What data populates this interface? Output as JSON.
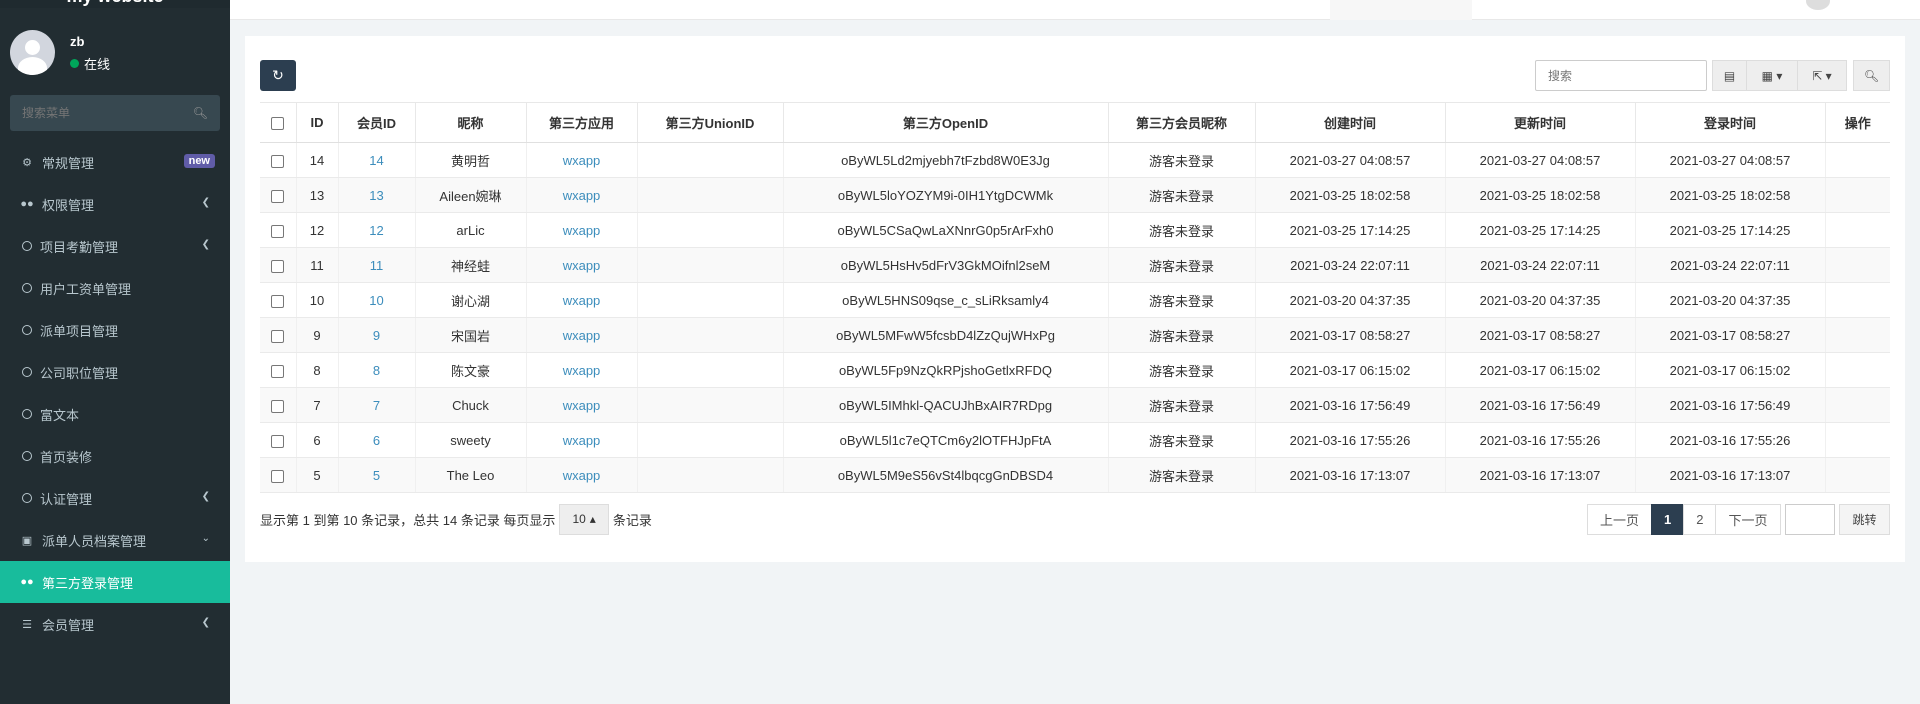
{
  "app": {
    "logo_text": "my website"
  },
  "user": {
    "name": "zb",
    "status": "在线"
  },
  "sidebar": {
    "search_placeholder": "搜索菜单",
    "items": [
      {
        "label": "常规管理",
        "icon": "cogs-icon",
        "badge": "new"
      },
      {
        "label": "权限管理",
        "icon": "group-icon",
        "arrow": "chevron-left-icon"
      },
      {
        "label": "项目考勤管理",
        "icon": "circle-icon",
        "arrow": "chevron-left-icon"
      },
      {
        "label": "用户工资单管理",
        "icon": "circle-icon"
      },
      {
        "label": "派单项目管理",
        "icon": "circle-icon"
      },
      {
        "label": "公司职位管理",
        "icon": "circle-icon"
      },
      {
        "label": "富文本",
        "icon": "circle-icon"
      },
      {
        "label": "首页装修",
        "icon": "circle-icon"
      },
      {
        "label": "认证管理",
        "icon": "circle-icon",
        "arrow": "chevron-left-icon"
      },
      {
        "label": "派单人员档案管理",
        "icon": "id-card-icon",
        "arrow": "chevron-down-icon"
      },
      {
        "label": "第三方登录管理",
        "icon": "users-icon",
        "active": true
      },
      {
        "label": "会员管理",
        "icon": "list-icon",
        "arrow": "chevron-left-icon"
      }
    ]
  },
  "toolbar": {
    "search_placeholder": "搜索"
  },
  "table": {
    "columns": [
      "ID",
      "会员ID",
      "昵称",
      "第三方应用",
      "第三方UnionID",
      "第三方OpenID",
      "第三方会员昵称",
      "创建时间",
      "更新时间",
      "登录时间",
      "操作"
    ],
    "rows": [
      {
        "id": "14",
        "member_id": "14",
        "nickname": "黄明哲",
        "app": "wxapp",
        "unionid": "",
        "openid": "oByWL5Ld2mjyebh7tFzbd8W0E3Jg",
        "third_nick": "游客未登录",
        "created": "2021-03-27 04:08:57",
        "updated": "2021-03-27 04:08:57",
        "login": "2021-03-27 04:08:57"
      },
      {
        "id": "13",
        "member_id": "13",
        "nickname": "Aileen婉琳",
        "app": "wxapp",
        "unionid": "",
        "openid": "oByWL5loYOZYM9i-0IH1YtgDCWMk",
        "third_nick": "游客未登录",
        "created": "2021-03-25 18:02:58",
        "updated": "2021-03-25 18:02:58",
        "login": "2021-03-25 18:02:58"
      },
      {
        "id": "12",
        "member_id": "12",
        "nickname": "arLic",
        "app": "wxapp",
        "unionid": "",
        "openid": "oByWL5CSaQwLaXNnrG0p5rArFxh0",
        "third_nick": "游客未登录",
        "created": "2021-03-25 17:14:25",
        "updated": "2021-03-25 17:14:25",
        "login": "2021-03-25 17:14:25"
      },
      {
        "id": "11",
        "member_id": "11",
        "nickname": "神经蛙",
        "app": "wxapp",
        "unionid": "",
        "openid": "oByWL5HsHv5dFrV3GkMOifnl2seM",
        "third_nick": "游客未登录",
        "created": "2021-03-24 22:07:11",
        "updated": "2021-03-24 22:07:11",
        "login": "2021-03-24 22:07:11"
      },
      {
        "id": "10",
        "member_id": "10",
        "nickname": "谢心湖",
        "app": "wxapp",
        "unionid": "",
        "openid": "oByWL5HNS09qse_c_sLiRksamly4",
        "third_nick": "游客未登录",
        "created": "2021-03-20 04:37:35",
        "updated": "2021-03-20 04:37:35",
        "login": "2021-03-20 04:37:35"
      },
      {
        "id": "9",
        "member_id": "9",
        "nickname": "宋国岩",
        "app": "wxapp",
        "unionid": "",
        "openid": "oByWL5MFwW5fcsbD4lZzQujWHxPg",
        "third_nick": "游客未登录",
        "created": "2021-03-17 08:58:27",
        "updated": "2021-03-17 08:58:27",
        "login": "2021-03-17 08:58:27"
      },
      {
        "id": "8",
        "member_id": "8",
        "nickname": "陈文豪",
        "app": "wxapp",
        "unionid": "",
        "openid": "oByWL5Fp9NzQkRPjshoGetlxRFDQ",
        "third_nick": "游客未登录",
        "created": "2021-03-17 06:15:02",
        "updated": "2021-03-17 06:15:02",
        "login": "2021-03-17 06:15:02"
      },
      {
        "id": "7",
        "member_id": "7",
        "nickname": "Chuck",
        "app": "wxapp",
        "unionid": "",
        "openid": "oByWL5IMhkl-QACUJhBxAIR7RDpg",
        "third_nick": "游客未登录",
        "created": "2021-03-16 17:56:49",
        "updated": "2021-03-16 17:56:49",
        "login": "2021-03-16 17:56:49"
      },
      {
        "id": "6",
        "member_id": "6",
        "nickname": "sweety",
        "app": "wxapp",
        "unionid": "",
        "openid": "oByWL5l1c7eQTCm6y2lOTFHJpFtA",
        "third_nick": "游客未登录",
        "created": "2021-03-16 17:55:26",
        "updated": "2021-03-16 17:55:26",
        "login": "2021-03-16 17:55:26"
      },
      {
        "id": "5",
        "member_id": "5",
        "nickname": "The Leo",
        "app": "wxapp",
        "unionid": "",
        "openid": "oByWL5M9eS56vSt4lbqcgGnDBSD4",
        "third_nick": "游客未登录",
        "created": "2021-03-16 17:13:07",
        "updated": "2021-03-16 17:13:07",
        "login": "2021-03-16 17:13:07"
      }
    ]
  },
  "footer": {
    "summary_prefix": "显示第 1 到第 10 条记录，总共 14 条记录 每页显示",
    "page_size": "10",
    "summary_suffix": "条记录",
    "prev": "上一页",
    "pages": [
      "1",
      "2"
    ],
    "active_page": "1",
    "next": "下一页",
    "jump": "跳转"
  },
  "colors": {
    "sidebar_bg": "#222d32",
    "active_menu": "#18bc9c",
    "primary_btn": "#2c3e50",
    "link": "#3c8dbc",
    "badge_new": "#605ca8"
  }
}
